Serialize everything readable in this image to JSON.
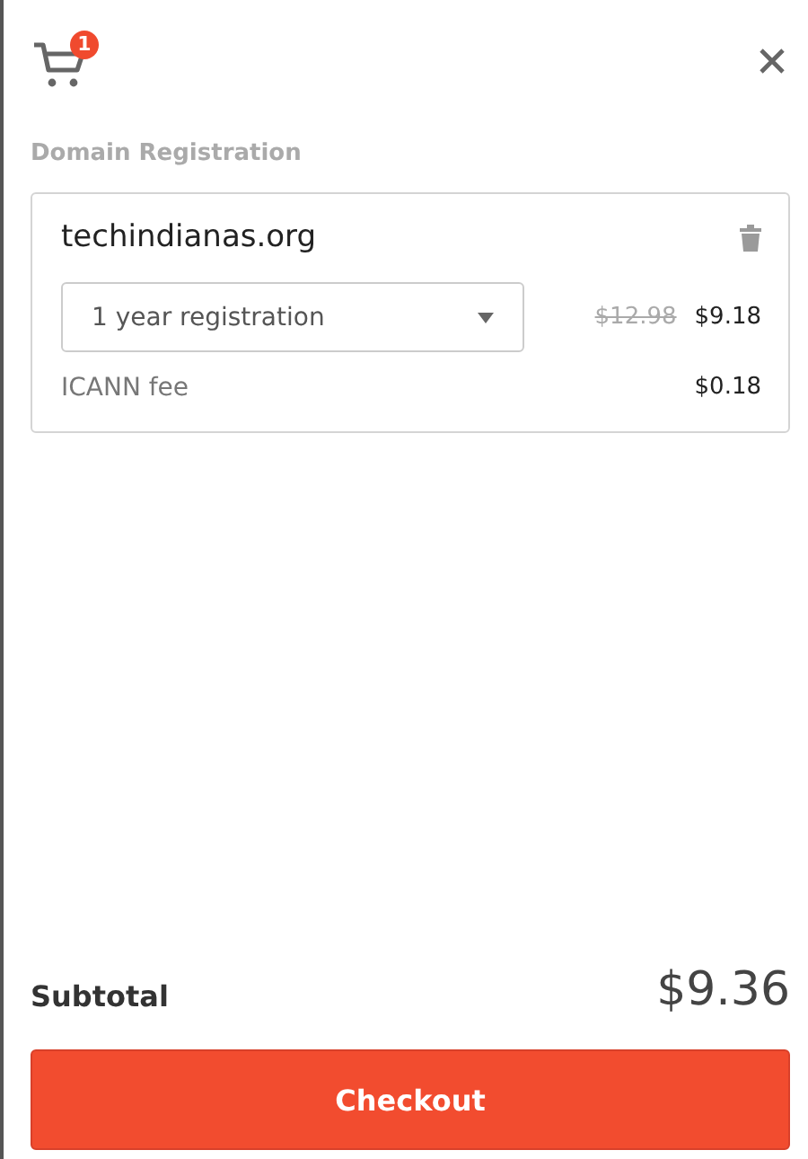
{
  "cart": {
    "count": "1"
  },
  "section_title": "Domain Registration",
  "items": [
    {
      "domain": "techindianas.org",
      "term": "1 year registration",
      "original_price": "$12.98",
      "price": "$9.18",
      "fee_label": "ICANN fee",
      "fee": "$0.18"
    }
  ],
  "subtotal": {
    "label": "Subtotal",
    "amount": "$9.36"
  },
  "checkout_button": "Checkout"
}
